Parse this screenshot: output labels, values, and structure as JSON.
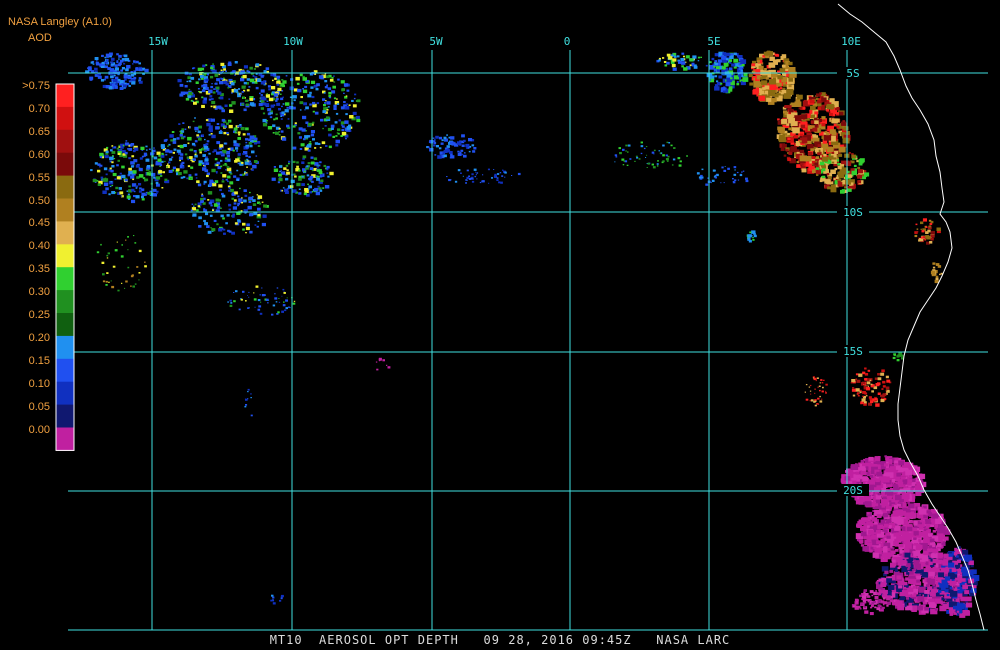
{
  "header": {
    "source": "NASA Langley (A1.0)",
    "product": "AOD"
  },
  "legend": {
    "labels": [
      ">0.75",
      "0.70",
      "0.65",
      "0.60",
      "0.55",
      "0.50",
      "0.45",
      "0.40",
      "0.35",
      "0.30",
      "0.25",
      "0.20",
      "0.15",
      "0.10",
      "0.05",
      "0.00"
    ],
    "colors": [
      "#ff2020",
      "#d01010",
      "#a01010",
      "#7a0a0a",
      "#8a6a10",
      "#b08020",
      "#e0b050",
      "#f0f030",
      "#30d030",
      "#209020",
      "#106010",
      "#2090f0",
      "#2050f0",
      "#1030c0",
      "#101870",
      "#c020a0"
    ]
  },
  "grid": {
    "lon_labels": [
      "15W",
      "10W",
      "5W",
      "0",
      "5E",
      "10E"
    ],
    "lat_labels": [
      "5S",
      "10S",
      "15S",
      "20S"
    ]
  },
  "footer": {
    "text": "MT10  AEROSOL OPT DEPTH   09 28, 2016 09:45Z   NASA LARC"
  },
  "colors": {
    "grid": "#40e0e0",
    "coast": "#ffffff",
    "label": "#f0a040"
  }
}
